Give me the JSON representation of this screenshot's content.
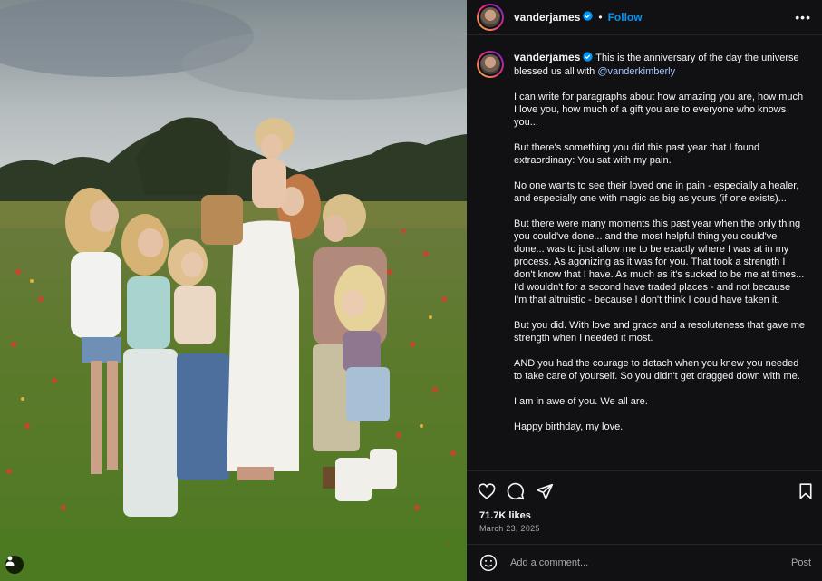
{
  "post": {
    "username": "vanderjames",
    "follow_label": "Follow",
    "more_label": "•••",
    "separator": "•",
    "caption": {
      "intro": "This is the anniversary of the day the universe blessed us all with",
      "mention": "@vanderkimberly",
      "paragraphs": [
        "I can write for paragraphs about how amazing you are, how much I love you, how much of a gift you are to everyone who knows you...",
        "But there's something you did this past year that I found extraordinary: You sat with my pain.",
        "No one wants to see their loved one in pain - especially a healer, and especially one with magic as big as yours (if one exists)...",
        "But there were many moments this past year when the only thing you could've done... and the most helpful thing you could've done... was to just allow me to be exactly where I was at in my process. As agonizing as it was for you. That took a strength I don't know that I have. As much as it's sucked to be me at times... I'd wouldn't for a second have traded places - and not because I'm that altruistic - because I don't think I could have taken it.",
        "But you did. With love and grace and a resoluteness that gave me strength when I needed it most.",
        "AND you had the courage to detach when you knew you needed to take care of yourself. So you didn't get dragged down with me.",
        "I am in awe of you. We all are.",
        "Happy birthday, my love."
      ]
    },
    "likes": "71.7K likes",
    "date": "March 23, 2025",
    "comment_placeholder": "Add a comment...",
    "post_label": "Post"
  },
  "icons": {
    "like": "heart-icon",
    "comment": "comment-icon",
    "share": "paper-plane-icon",
    "save": "bookmark-icon",
    "emoji": "smiley-icon",
    "tagged": "person-icon",
    "verified": "verified-badge-icon"
  },
  "colors": {
    "panel_bg": "#111113",
    "accent": "#0095f6",
    "mention": "#a5c8ff",
    "muted": "#a8a8a8"
  }
}
